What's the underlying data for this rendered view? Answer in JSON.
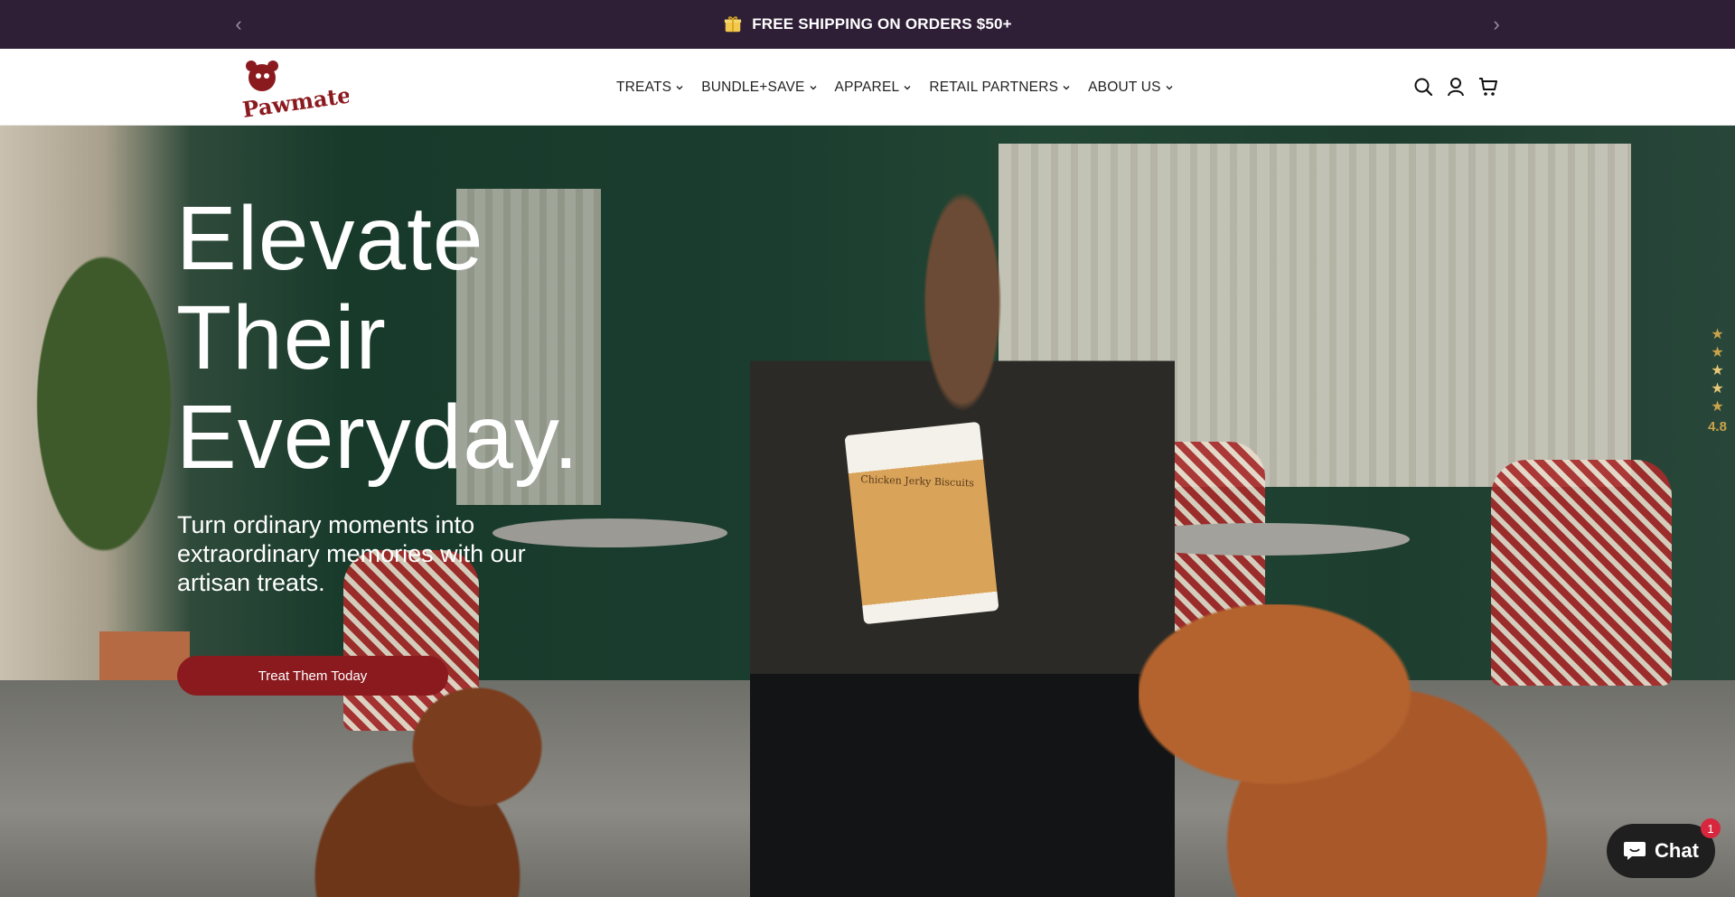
{
  "announcement": {
    "text": "FREE SHIPPING ON ORDERS $50+",
    "prev_icon": "chevron-left-icon",
    "next_icon": "chevron-right-icon",
    "icon": "gift-icon"
  },
  "header": {
    "logo_text": "Pawmate",
    "nav": [
      {
        "label": "TREATS"
      },
      {
        "label": "BUNDLE+SAVE"
      },
      {
        "label": "APPAREL"
      },
      {
        "label": "RETAIL PARTNERS"
      },
      {
        "label": "ABOUT US"
      }
    ],
    "icons": [
      "search-icon",
      "account-icon",
      "cart-icon"
    ]
  },
  "hero": {
    "title_line1": "Elevate",
    "title_line2": "Their",
    "title_line3": "Everyday.",
    "subtitle": "Turn ordinary moments into extraordinary memories with our artisan treats.",
    "cta_label": "Treat Them Today",
    "product_label": "Chicken Jerky Biscuits"
  },
  "reviews": {
    "score": "4.8"
  },
  "chat": {
    "label": "Chat",
    "badge": "1"
  },
  "colors": {
    "announcement_bg": "#2e1f36",
    "cta": "#8b1a1f",
    "star": "#c9a24a",
    "chat_bg": "#1f1f1f",
    "badge": "#d7263d"
  }
}
